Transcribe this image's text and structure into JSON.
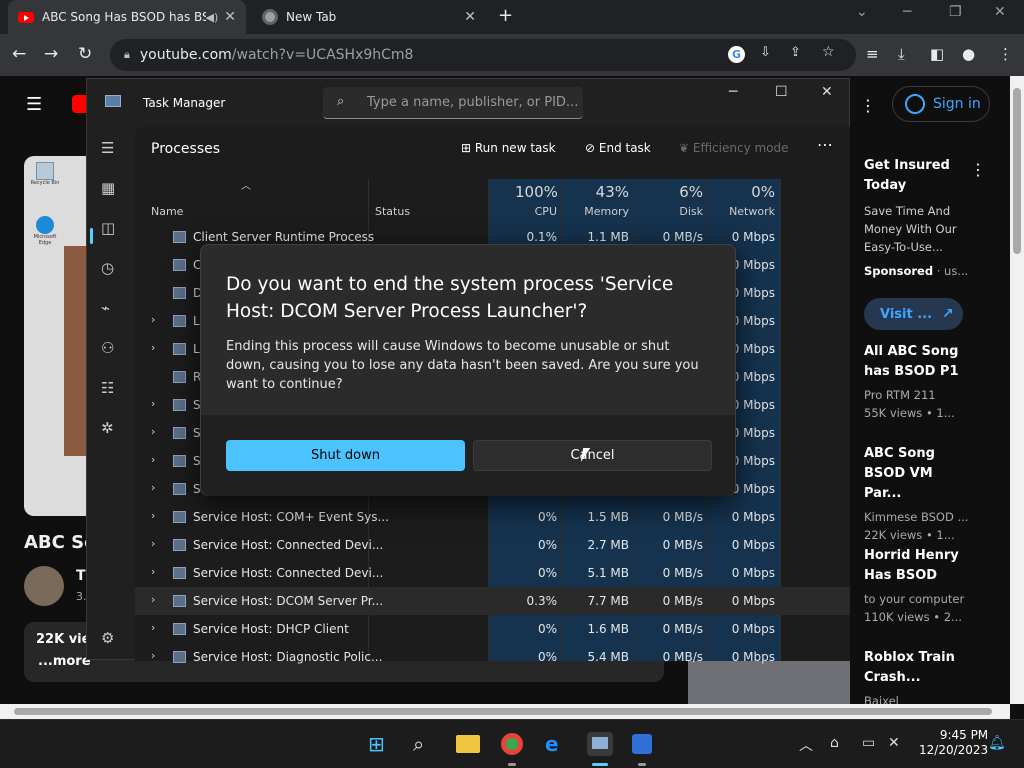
{
  "browser": {
    "tabs": [
      {
        "title": "ABC Song Has BSOD has BSO",
        "active": true
      },
      {
        "title": "New Tab",
        "active": false
      }
    ],
    "url_host": "youtube.com",
    "url_path": "/watch?v=UCASHx9hCm8"
  },
  "youtube": {
    "signin_label": "Sign in",
    "ad": {
      "title": "Get Insured Today",
      "description": "Save Time And Money With Our Easy-To-Use...",
      "sponsored_label": "Sponsored",
      "sponsored_suffix": " · us...",
      "visit_label": "Visit ..."
    },
    "recommendations": [
      {
        "title": "All ABC Song has BSOD P1",
        "channel": "Pro RTM 211",
        "meta": "55K views • 1..."
      },
      {
        "title": "ABC Song BSOD VM Par...",
        "channel": "Kimmese BSOD ...",
        "meta": "22K views • 1..."
      },
      {
        "title": "Horrid Henry Has BSOD",
        "channel": "to your computer",
        "meta": "110K views • 2..."
      },
      {
        "title": "Roblox Train Crash...",
        "channel": "Baixel",
        "meta": ""
      }
    ],
    "video_title_partial": "ABC So",
    "channel_initial": "T",
    "sub_partial": "3.",
    "views_partial": "22K vie",
    "more_label": "...more"
  },
  "task_manager": {
    "title": "Task Manager",
    "search_placeholder": "Type a name, publisher, or PID...",
    "page_title": "Processes",
    "actions": {
      "run_new_task": "Run new task",
      "end_task": "End task",
      "efficiency_mode": "Efficiency mode"
    },
    "columns": {
      "name": "Name",
      "status": "Status",
      "cpu_pct": "100%",
      "cpu": "CPU",
      "mem_pct": "43%",
      "mem": "Memory",
      "disk_pct": "6%",
      "disk": "Disk",
      "net_pct": "0%",
      "net": "Network"
    },
    "rows": [
      {
        "name": "Client Server Runtime Process",
        "expand": false,
        "cpu": "0.1%",
        "mem": "1.1 MB",
        "disk": "0 MB/s",
        "net": "0 Mbps"
      },
      {
        "name": "C",
        "expand": false,
        "cpu": "",
        "mem": "",
        "disk": "",
        "net": "0 Mbps"
      },
      {
        "name": "D",
        "expand": false,
        "cpu": "",
        "mem": "",
        "disk": "",
        "net": "0 Mbps"
      },
      {
        "name": "L",
        "expand": true,
        "cpu": "",
        "mem": "",
        "disk": "",
        "net": "0 Mbps"
      },
      {
        "name": "L",
        "expand": true,
        "cpu": "",
        "mem": "",
        "disk": "",
        "net": "0 Mbps"
      },
      {
        "name": "R",
        "expand": false,
        "cpu": "",
        "mem": "",
        "disk": "",
        "net": "0 Mbps"
      },
      {
        "name": "S",
        "expand": true,
        "cpu": "",
        "mem": "",
        "disk": "",
        "net": "0 Mbps"
      },
      {
        "name": "S",
        "expand": true,
        "cpu": "",
        "mem": "",
        "disk": "",
        "net": "0 Mbps"
      },
      {
        "name": "S",
        "expand": true,
        "cpu": "",
        "mem": "",
        "disk": "",
        "net": "0 Mbps"
      },
      {
        "name": "S",
        "expand": true,
        "cpu": "",
        "mem": "",
        "disk": "",
        "net": "0 Mbps"
      },
      {
        "name": "Service Host: COM+ Event Sys...",
        "expand": true,
        "cpu": "0%",
        "mem": "1.5 MB",
        "disk": "0 MB/s",
        "net": "0 Mbps"
      },
      {
        "name": "Service Host: Connected Devi...",
        "expand": true,
        "cpu": "0%",
        "mem": "2.7 MB",
        "disk": "0 MB/s",
        "net": "0 Mbps"
      },
      {
        "name": "Service Host: Connected Devi...",
        "expand": true,
        "cpu": "0%",
        "mem": "5.1 MB",
        "disk": "0 MB/s",
        "net": "0 Mbps"
      },
      {
        "name": "Service Host: DCOM Server Pr...",
        "expand": true,
        "cpu": "0.3%",
        "mem": "7.7 MB",
        "disk": "0 MB/s",
        "net": "0 Mbps",
        "highlight": true
      },
      {
        "name": "Service Host: DHCP Client",
        "expand": true,
        "cpu": "0%",
        "mem": "1.6 MB",
        "disk": "0 MB/s",
        "net": "0 Mbps"
      },
      {
        "name": "Service Host: Diagnostic Polic...",
        "expand": true,
        "cpu": "0%",
        "mem": "5.4 MB",
        "disk": "0 MB/s",
        "net": "0 Mbps"
      }
    ]
  },
  "dialog": {
    "title": "Do you want to end the system process 'Service Host: DCOM Server Process Launcher'?",
    "body": "Ending this process will cause Windows to become unusable or shut down, causing you to lose any data hasn't been saved. Are you sure you want to continue?",
    "primary_label": "Shut down",
    "secondary_label": "Cancel"
  },
  "taskbar": {
    "time": "9:45 PM",
    "date": "12/20/2023"
  },
  "desktop_icons": [
    {
      "label": "Recycle Bin"
    },
    {
      "label": "Microsoft Edge"
    }
  ],
  "colors": {
    "accent": "#4cc2ff",
    "youtube_red": "#ff0000",
    "link_blue": "#3ea6ff"
  }
}
